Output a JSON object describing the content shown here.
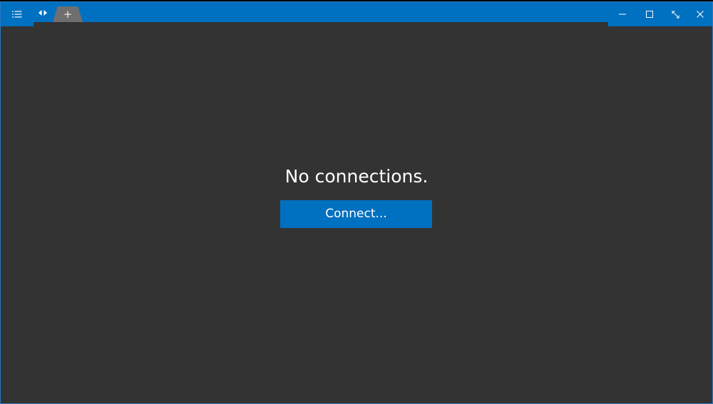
{
  "window": {
    "accent_color": "#0070c0",
    "background_color": "#333333"
  },
  "titlebar": {
    "menu_icon": "hamburger-list-icon",
    "tab_switch_icon": "left-right-arrows-icon",
    "new_tab_label": "+",
    "controls": [
      "minimize-icon",
      "maximize-icon",
      "fullscreen-icon",
      "close-icon"
    ]
  },
  "main": {
    "empty_message": "No connections.",
    "connect_label": "Connect..."
  }
}
